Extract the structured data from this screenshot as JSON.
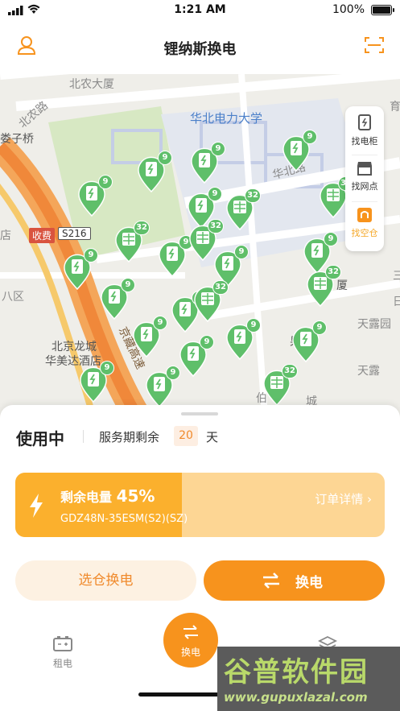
{
  "status_bar": {
    "time": "1:21 AM",
    "battery_pct": "100%"
  },
  "header": {
    "title": "锂纳斯换电",
    "user_icon": "user-icon",
    "scan_icon": "scan-icon"
  },
  "map": {
    "labels": {
      "beinong_dasha": "北农大厦",
      "beinong_lu": "北农路",
      "huabei_dianli": "华北电力大学",
      "huabei_lu": "华北路",
      "zi_qiao": "娄子桥",
      "toll": "收费",
      "road_no": "S216",
      "hotel_line1": "北京龙城",
      "hotel_line2": "华美达酒店",
      "ba_qu": "八区",
      "tianlu_yuan": "天露园",
      "tianlu": "天露",
      "guodong": "果栋",
      "dasha_partial": "厦",
      "gaosu": "京藏高速",
      "you": "育",
      "dian": "店",
      "bai": "伯",
      "cheng": "城",
      "san": "三",
      "ri": "日"
    },
    "markers": [
      {
        "type": "cabinet",
        "count": "9"
      },
      {
        "type": "cabinet",
        "count": "9"
      },
      {
        "type": "cabinet",
        "count": "9"
      },
      {
        "type": "cabinet",
        "count": "9"
      },
      {
        "type": "cabinet",
        "count": "9"
      },
      {
        "type": "cabinet",
        "count": "9"
      },
      {
        "type": "cabinet",
        "count": "9"
      },
      {
        "type": "cabinet",
        "count": "9"
      },
      {
        "type": "cabinet",
        "count": "9"
      },
      {
        "type": "cabinet",
        "count": "9"
      },
      {
        "type": "cabinet",
        "count": "9"
      },
      {
        "type": "cabinet",
        "count": "9"
      },
      {
        "type": "cabinet",
        "count": "9"
      },
      {
        "type": "cabinet",
        "count": "9"
      },
      {
        "type": "cabinet",
        "count": "9"
      },
      {
        "type": "cabinet",
        "count": "9"
      },
      {
        "type": "cabinet",
        "count": "9"
      },
      {
        "type": "grid",
        "count": "32"
      },
      {
        "type": "grid",
        "count": "32"
      },
      {
        "type": "grid",
        "count": "32"
      },
      {
        "type": "grid",
        "count": "32"
      },
      {
        "type": "grid",
        "count": "32"
      },
      {
        "type": "grid",
        "count": "32"
      },
      {
        "type": "grid",
        "count": "32"
      }
    ],
    "panel": {
      "find_cabinet": "找电柜",
      "find_outlet": "找网点",
      "find_empty": "找空仓"
    }
  },
  "sheet": {
    "status": "使用中",
    "service_label": "服务期剩余",
    "days": "20",
    "days_unit": "天",
    "battery": {
      "remain_label": "剩余电量",
      "percent": "45%",
      "level": 0.45,
      "model": "GDZ48N-35ESM(S2)(SZ)",
      "detail_link": "订单详情 ›"
    },
    "btn_select": "选仓换电",
    "btn_swap": "换电"
  },
  "tabbar": {
    "rent": "租电",
    "swap": "换电"
  },
  "watermark": {
    "title": "谷普软件园",
    "url": "www.gupuxlazal.com"
  },
  "colors": {
    "accent": "#f7931d",
    "marker_green": "#5fbf6a",
    "battery_fill": "#fbb02d"
  }
}
